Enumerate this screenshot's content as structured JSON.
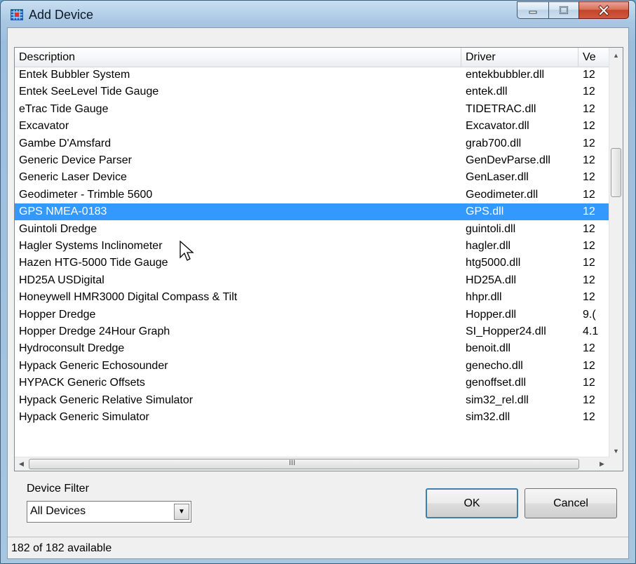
{
  "window": {
    "title": "Add Device",
    "app_icon": "hypack-grid-icon",
    "controls": {
      "minimize": "minimize-icon",
      "maximize": "maximize-icon",
      "close": "close-icon"
    }
  },
  "list": {
    "columns": [
      "Description",
      "Driver",
      "Ve"
    ],
    "rows": [
      {
        "description": "Entek Bubbler System",
        "driver": "entekbubbler.dll",
        "version": "12"
      },
      {
        "description": "Entek SeeLevel Tide Gauge",
        "driver": "entek.dll",
        "version": "12"
      },
      {
        "description": "eTrac Tide Gauge",
        "driver": "TIDETRAC.dll",
        "version": "12"
      },
      {
        "description": "Excavator",
        "driver": "Excavator.dll",
        "version": "12"
      },
      {
        "description": "Gambe D'Amsfard",
        "driver": "grab700.dll",
        "version": "12"
      },
      {
        "description": "Generic Device Parser",
        "driver": "GenDevParse.dll",
        "version": "12"
      },
      {
        "description": "Generic Laser Device",
        "driver": "GenLaser.dll",
        "version": "12"
      },
      {
        "description": "Geodimeter - Trimble 5600",
        "driver": "Geodimeter.dll",
        "version": "12"
      },
      {
        "description": "GPS NMEA-0183",
        "driver": "GPS.dll",
        "version": "12",
        "selected": true
      },
      {
        "description": "Guintoli Dredge",
        "driver": "guintoli.dll",
        "version": "12"
      },
      {
        "description": "Hagler Systems Inclinometer",
        "driver": "hagler.dll",
        "version": "12"
      },
      {
        "description": "Hazen HTG-5000 Tide Gauge",
        "driver": "htg5000.dll",
        "version": "12"
      },
      {
        "description": "HD25A USDigital",
        "driver": "HD25A.dll",
        "version": "12"
      },
      {
        "description": "Honeywell HMR3000 Digital Compass & Tilt",
        "driver": "hhpr.dll",
        "version": "12"
      },
      {
        "description": "Hopper Dredge",
        "driver": "Hopper.dll",
        "version": "9.("
      },
      {
        "description": "Hopper Dredge 24Hour Graph",
        "driver": "SI_Hopper24.dll",
        "version": "4.1"
      },
      {
        "description": "Hydroconsult Dredge",
        "driver": "benoit.dll",
        "version": "12"
      },
      {
        "description": "Hypack Generic Echosounder",
        "driver": "genecho.dll",
        "version": "12"
      },
      {
        "description": "HYPACK Generic Offsets",
        "driver": "genoffset.dll",
        "version": "12"
      },
      {
        "description": "Hypack Generic Relative Simulator",
        "driver": "sim32_rel.dll",
        "version": "12"
      },
      {
        "description": "Hypack Generic Simulator",
        "driver": "sim32.dll",
        "version": "12"
      }
    ],
    "horizontal_scroll_grip": "III"
  },
  "filter": {
    "label": "Device Filter",
    "selected": "All Devices"
  },
  "buttons": {
    "ok": "OK",
    "cancel": "Cancel"
  },
  "status": "182 of 182 available"
}
